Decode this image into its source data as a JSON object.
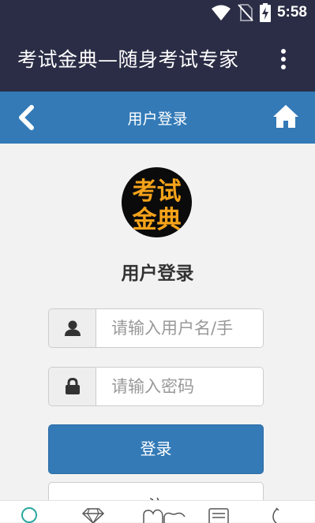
{
  "status_bar": {
    "time": "5:58",
    "icons": [
      "wifi-icon",
      "no-sim-icon",
      "battery-charging-icon"
    ]
  },
  "app_bar": {
    "title": "考试金典—随身考试专家",
    "menu_icon": "more-vert-icon"
  },
  "nav_bar": {
    "title": "用户登录",
    "back_icon": "chevron-left-icon",
    "home_icon": "home-icon"
  },
  "logo": {
    "line1": "考试",
    "line2": "金典"
  },
  "login": {
    "heading": "用户登录",
    "username_placeholder": "请输入用户名/手",
    "username_value": "",
    "password_placeholder": "请输入密码",
    "password_value": "",
    "login_button": "登录",
    "second_button": "注"
  },
  "tab_bar": {
    "tabs": [
      "search-icon",
      "diamond-icon",
      "hands-icon",
      "document-icon",
      "phone-icon"
    ]
  },
  "colors": {
    "app_bar": "#2a2d45",
    "nav_bar": "#337ab7",
    "primary_button": "#337ab7",
    "logo_text": "#f5a31a",
    "background": "#f2f2f2"
  }
}
